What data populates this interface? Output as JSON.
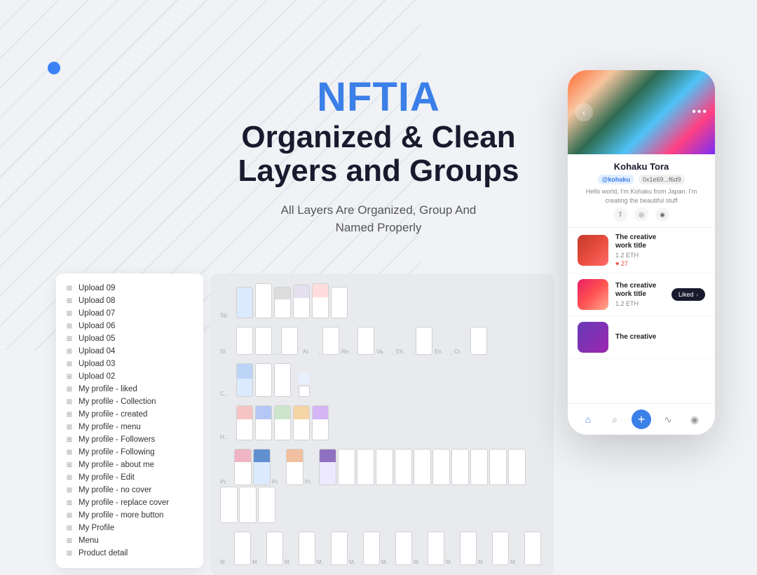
{
  "app": {
    "title": "NFTIA"
  },
  "hero": {
    "title": "NFTIA",
    "subtitle_line1": "Organized & Clean",
    "subtitle_line2": "Layers and Groups",
    "description_line1": "All Layers Are Organized, Group And",
    "description_line2": "Named Properly"
  },
  "blue_dot": true,
  "layers": {
    "items": [
      "Upload 09",
      "Upload 08",
      "Upload 07",
      "Upload 06",
      "Upload 05",
      "Upload 04",
      "Upload 03",
      "Upload 02",
      "My profile - liked",
      "My profile - Collection",
      "My profile - created",
      "My profile - menu",
      "My profile - Followers",
      "My profile - Following",
      "My profile - about me",
      "My profile - Edit",
      "My profile - no cover",
      "My profile - replace cover",
      "My profile - more button",
      "My Profile",
      "Menu",
      "Product detail"
    ]
  },
  "phone": {
    "user": {
      "name": "Kohaku Tora",
      "handle": "@kohaku",
      "wallet": "0x1e69...f6d9",
      "bio": "Hello world, I'm Kohaku from Japan. I'm creating the beautiful stuff"
    },
    "social_icons": [
      "twitter",
      "instagram",
      "pinterest"
    ],
    "nft_items": [
      {
        "title": "The creative work title",
        "price": "1.2 ETH",
        "likes": "27",
        "thumb_color": "red"
      },
      {
        "title": "The creative work title",
        "price": "1.2 ETH",
        "action": "Liked",
        "thumb_color": "pink"
      },
      {
        "title": "The creative",
        "price": "",
        "thumb_color": "purple"
      }
    ],
    "nav": [
      "home",
      "search",
      "add",
      "activity",
      "profile"
    ]
  },
  "icons": {
    "grid": "⊞",
    "back": "‹",
    "dots": "•••",
    "home": "⌂",
    "search": "⌕",
    "add": "+",
    "activity": "∿",
    "profile": "◉",
    "twitter": "𝕋",
    "instagram": "◎",
    "pinterest": "◉",
    "heart": "♥",
    "chevron_down": "›"
  },
  "colors": {
    "accent_blue": "#3B7FE8",
    "dark": "#1a1a2e",
    "bg": "#f0f2f5",
    "card_bg": "#ffffff"
  }
}
